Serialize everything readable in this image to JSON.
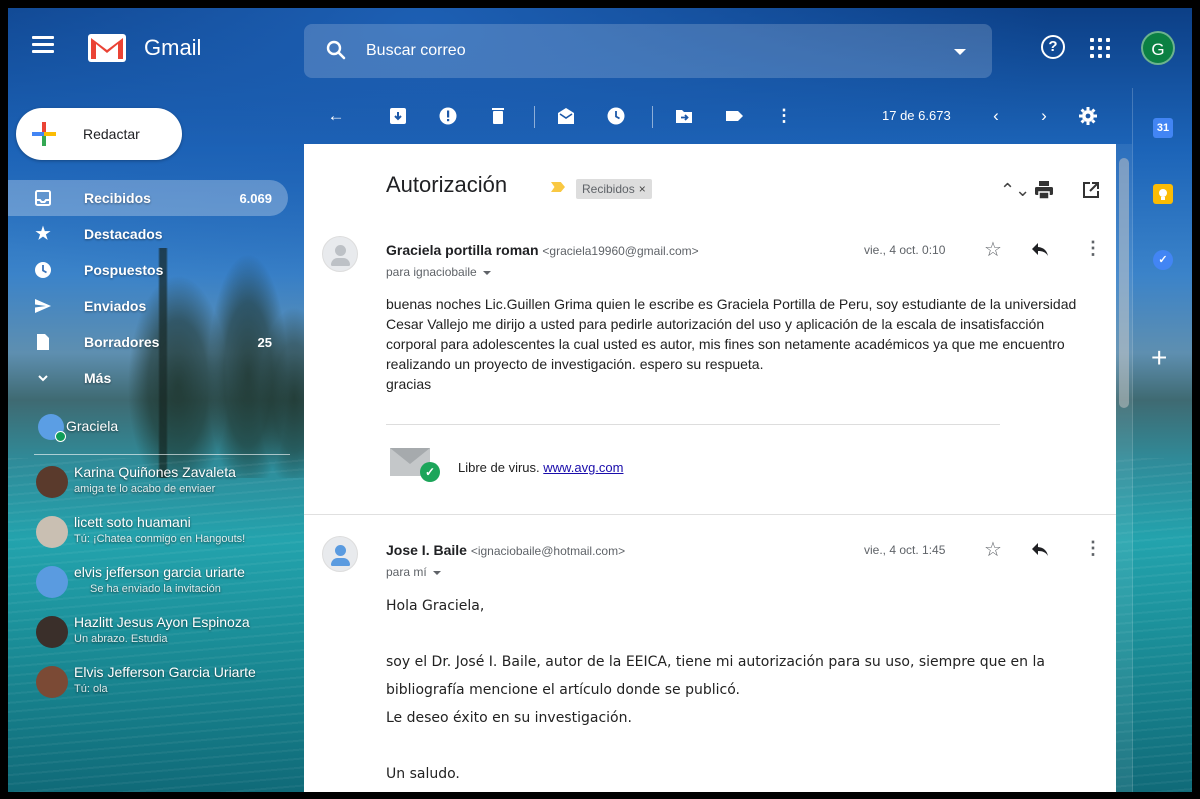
{
  "app": {
    "name": "Gmail"
  },
  "search": {
    "placeholder": "Buscar correo"
  },
  "header": {
    "help_icon": "help-icon",
    "apps_icon": "apps-grid-icon",
    "avatar_letter": "G"
  },
  "compose": {
    "label": "Redactar"
  },
  "nav": [
    {
      "label": "Recibidos",
      "count": "6.069",
      "icon": "inbox-icon",
      "active": true
    },
    {
      "label": "Destacados",
      "count": "",
      "icon": "star-icon"
    },
    {
      "label": "Pospuestos",
      "count": "",
      "icon": "clock-icon"
    },
    {
      "label": "Enviados",
      "count": "",
      "icon": "send-icon"
    },
    {
      "label": "Borradores",
      "count": "25",
      "icon": "draft-icon"
    },
    {
      "label": "Más",
      "count": "",
      "icon": "chevron-down-icon"
    }
  ],
  "hangouts": {
    "me": "Graciela",
    "contacts": [
      {
        "name": "Karina Quiñones Zavaleta",
        "message": "amiga te lo acabo de enviaer",
        "color": "#5a3a2c"
      },
      {
        "name": "licett soto huamani",
        "message": "Tú: ¡Chatea conmigo en Hangouts!",
        "color": "#c9bfb2"
      },
      {
        "name": "elvis jefferson garcia uriarte",
        "message": "Se ha enviado la invitación",
        "color": "#5a9be0"
      },
      {
        "name": "Hazlitt Jesus Ayon Espinoza",
        "message": "Un abrazo. Estudia",
        "color": "#3a2f2a"
      },
      {
        "name": "Elvis Jefferson Garcia Uriarte",
        "message": "Tú: ola",
        "color": "#7b4a35"
      }
    ]
  },
  "toolbar": {
    "pager": "17 de 6.673"
  },
  "thread": {
    "subject": "Autorización",
    "label": "Recibidos",
    "messages": [
      {
        "sender": "Graciela portilla roman",
        "email": "<graciela19960@gmail.com>",
        "to": "para ignaciobaile",
        "date": "vie., 4 oct. 0:10",
        "body": [
          "buenas noches Lic.Guillen Grima quien le escribe es Graciela Portilla de Peru, soy estudiante de la universidad Cesar Vallejo me dirijo a usted para pedirle autorización del uso y aplicación de la escala de insatisfacción corporal para adolescentes la cual usted es autor, mis fines son netamente académicos ya que me encuentro realizando un proyecto de investigación. espero su respueta.",
          "gracias"
        ],
        "signature_text": "Libre de virus.",
        "signature_link": "www.avg.com"
      },
      {
        "sender": "Jose I. Baile",
        "email": "<ignaciobaile@hotmail.com>",
        "to": "para mí",
        "date": "vie., 4 oct. 1:45",
        "body": [
          "Hola Graciela,",
          "soy el Dr. José I. Baile, autor de la EEICA, tiene mi autorización para su uso, siempre que en la bibliografía mencione el artículo donde se publicó.",
          "Le deseo éxito en su investigación.",
          "Un saludo."
        ]
      }
    ]
  }
}
